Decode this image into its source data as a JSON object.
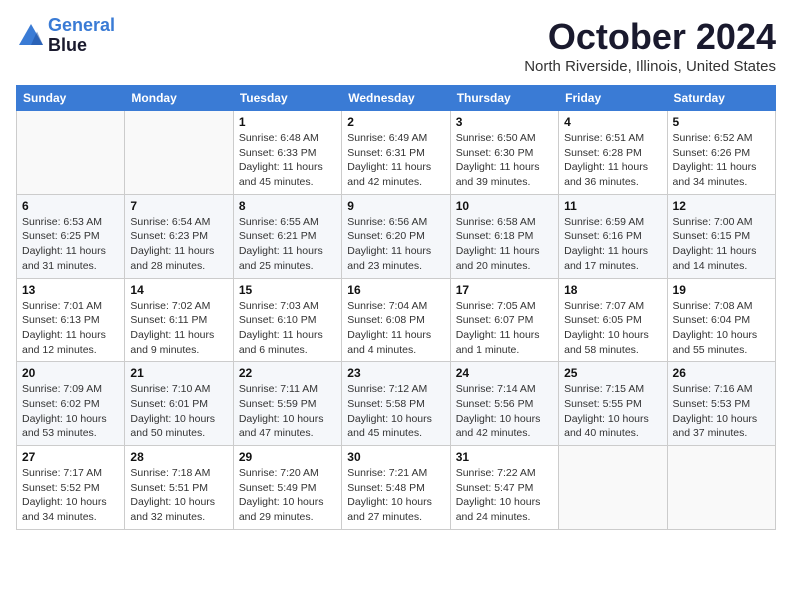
{
  "logo": {
    "line1": "General",
    "line2": "Blue"
  },
  "title": "October 2024",
  "subtitle": "North Riverside, Illinois, United States",
  "headers": [
    "Sunday",
    "Monday",
    "Tuesday",
    "Wednesday",
    "Thursday",
    "Friday",
    "Saturday"
  ],
  "weeks": [
    [
      {
        "day": "",
        "sunrise": "",
        "sunset": "",
        "daylight": ""
      },
      {
        "day": "",
        "sunrise": "",
        "sunset": "",
        "daylight": ""
      },
      {
        "day": "1",
        "sunrise": "Sunrise: 6:48 AM",
        "sunset": "Sunset: 6:33 PM",
        "daylight": "Daylight: 11 hours and 45 minutes."
      },
      {
        "day": "2",
        "sunrise": "Sunrise: 6:49 AM",
        "sunset": "Sunset: 6:31 PM",
        "daylight": "Daylight: 11 hours and 42 minutes."
      },
      {
        "day": "3",
        "sunrise": "Sunrise: 6:50 AM",
        "sunset": "Sunset: 6:30 PM",
        "daylight": "Daylight: 11 hours and 39 minutes."
      },
      {
        "day": "4",
        "sunrise": "Sunrise: 6:51 AM",
        "sunset": "Sunset: 6:28 PM",
        "daylight": "Daylight: 11 hours and 36 minutes."
      },
      {
        "day": "5",
        "sunrise": "Sunrise: 6:52 AM",
        "sunset": "Sunset: 6:26 PM",
        "daylight": "Daylight: 11 hours and 34 minutes."
      }
    ],
    [
      {
        "day": "6",
        "sunrise": "Sunrise: 6:53 AM",
        "sunset": "Sunset: 6:25 PM",
        "daylight": "Daylight: 11 hours and 31 minutes."
      },
      {
        "day": "7",
        "sunrise": "Sunrise: 6:54 AM",
        "sunset": "Sunset: 6:23 PM",
        "daylight": "Daylight: 11 hours and 28 minutes."
      },
      {
        "day": "8",
        "sunrise": "Sunrise: 6:55 AM",
        "sunset": "Sunset: 6:21 PM",
        "daylight": "Daylight: 11 hours and 25 minutes."
      },
      {
        "day": "9",
        "sunrise": "Sunrise: 6:56 AM",
        "sunset": "Sunset: 6:20 PM",
        "daylight": "Daylight: 11 hours and 23 minutes."
      },
      {
        "day": "10",
        "sunrise": "Sunrise: 6:58 AM",
        "sunset": "Sunset: 6:18 PM",
        "daylight": "Daylight: 11 hours and 20 minutes."
      },
      {
        "day": "11",
        "sunrise": "Sunrise: 6:59 AM",
        "sunset": "Sunset: 6:16 PM",
        "daylight": "Daylight: 11 hours and 17 minutes."
      },
      {
        "day": "12",
        "sunrise": "Sunrise: 7:00 AM",
        "sunset": "Sunset: 6:15 PM",
        "daylight": "Daylight: 11 hours and 14 minutes."
      }
    ],
    [
      {
        "day": "13",
        "sunrise": "Sunrise: 7:01 AM",
        "sunset": "Sunset: 6:13 PM",
        "daylight": "Daylight: 11 hours and 12 minutes."
      },
      {
        "day": "14",
        "sunrise": "Sunrise: 7:02 AM",
        "sunset": "Sunset: 6:11 PM",
        "daylight": "Daylight: 11 hours and 9 minutes."
      },
      {
        "day": "15",
        "sunrise": "Sunrise: 7:03 AM",
        "sunset": "Sunset: 6:10 PM",
        "daylight": "Daylight: 11 hours and 6 minutes."
      },
      {
        "day": "16",
        "sunrise": "Sunrise: 7:04 AM",
        "sunset": "Sunset: 6:08 PM",
        "daylight": "Daylight: 11 hours and 4 minutes."
      },
      {
        "day": "17",
        "sunrise": "Sunrise: 7:05 AM",
        "sunset": "Sunset: 6:07 PM",
        "daylight": "Daylight: 11 hours and 1 minute."
      },
      {
        "day": "18",
        "sunrise": "Sunrise: 7:07 AM",
        "sunset": "Sunset: 6:05 PM",
        "daylight": "Daylight: 10 hours and 58 minutes."
      },
      {
        "day": "19",
        "sunrise": "Sunrise: 7:08 AM",
        "sunset": "Sunset: 6:04 PM",
        "daylight": "Daylight: 10 hours and 55 minutes."
      }
    ],
    [
      {
        "day": "20",
        "sunrise": "Sunrise: 7:09 AM",
        "sunset": "Sunset: 6:02 PM",
        "daylight": "Daylight: 10 hours and 53 minutes."
      },
      {
        "day": "21",
        "sunrise": "Sunrise: 7:10 AM",
        "sunset": "Sunset: 6:01 PM",
        "daylight": "Daylight: 10 hours and 50 minutes."
      },
      {
        "day": "22",
        "sunrise": "Sunrise: 7:11 AM",
        "sunset": "Sunset: 5:59 PM",
        "daylight": "Daylight: 10 hours and 47 minutes."
      },
      {
        "day": "23",
        "sunrise": "Sunrise: 7:12 AM",
        "sunset": "Sunset: 5:58 PM",
        "daylight": "Daylight: 10 hours and 45 minutes."
      },
      {
        "day": "24",
        "sunrise": "Sunrise: 7:14 AM",
        "sunset": "Sunset: 5:56 PM",
        "daylight": "Daylight: 10 hours and 42 minutes."
      },
      {
        "day": "25",
        "sunrise": "Sunrise: 7:15 AM",
        "sunset": "Sunset: 5:55 PM",
        "daylight": "Daylight: 10 hours and 40 minutes."
      },
      {
        "day": "26",
        "sunrise": "Sunrise: 7:16 AM",
        "sunset": "Sunset: 5:53 PM",
        "daylight": "Daylight: 10 hours and 37 minutes."
      }
    ],
    [
      {
        "day": "27",
        "sunrise": "Sunrise: 7:17 AM",
        "sunset": "Sunset: 5:52 PM",
        "daylight": "Daylight: 10 hours and 34 minutes."
      },
      {
        "day": "28",
        "sunrise": "Sunrise: 7:18 AM",
        "sunset": "Sunset: 5:51 PM",
        "daylight": "Daylight: 10 hours and 32 minutes."
      },
      {
        "day": "29",
        "sunrise": "Sunrise: 7:20 AM",
        "sunset": "Sunset: 5:49 PM",
        "daylight": "Daylight: 10 hours and 29 minutes."
      },
      {
        "day": "30",
        "sunrise": "Sunrise: 7:21 AM",
        "sunset": "Sunset: 5:48 PM",
        "daylight": "Daylight: 10 hours and 27 minutes."
      },
      {
        "day": "31",
        "sunrise": "Sunrise: 7:22 AM",
        "sunset": "Sunset: 5:47 PM",
        "daylight": "Daylight: 10 hours and 24 minutes."
      },
      {
        "day": "",
        "sunrise": "",
        "sunset": "",
        "daylight": ""
      },
      {
        "day": "",
        "sunrise": "",
        "sunset": "",
        "daylight": ""
      }
    ]
  ]
}
